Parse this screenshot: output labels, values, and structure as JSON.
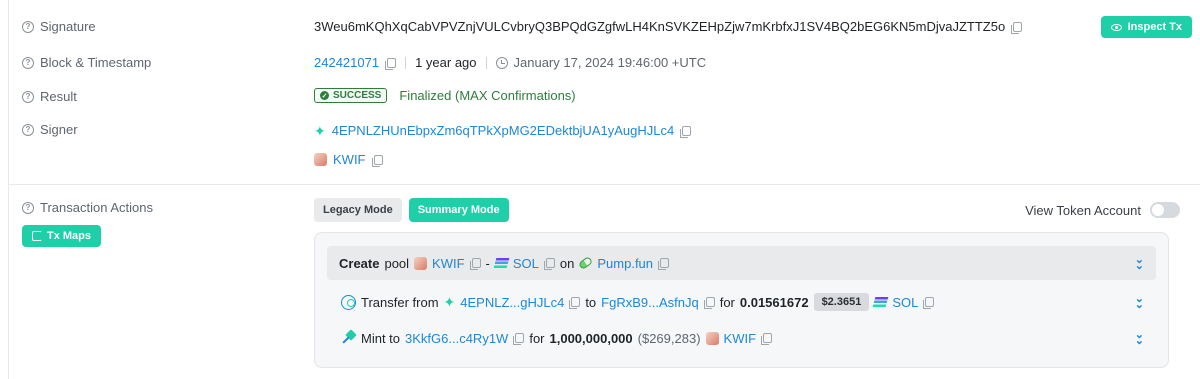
{
  "signature": {
    "label": "Signature",
    "value": "3Weu6mKQhXqCabVPVZnjVULCvbryQ3BPQdGZgfwLH4KnSVKZEHpZjw7mKrbfxJ1SV4BQ2bEG6KN5mDjvaJZTTZ5o",
    "inspect_label": "Inspect Tx"
  },
  "block": {
    "label": "Block & Timestamp",
    "number": "242421071",
    "ago": "1 year ago",
    "timestamp": "January 17, 2024 19:46:00 +UTC"
  },
  "result": {
    "label": "Result",
    "status": "SUCCESS",
    "finalized": "Finalized (MAX Confirmations)"
  },
  "signer": {
    "label": "Signer",
    "address": "4EPNLZHUnEbpxZm6qTPkXpMG2EDektbjUA1yAugHJLc4",
    "token": "KWIF"
  },
  "actions": {
    "label": "Transaction Actions",
    "tx_maps": "Tx Maps",
    "legacy_mode": "Legacy Mode",
    "summary_mode": "Summary Mode",
    "view_token_account": "View Token Account",
    "create": {
      "verb": "Create",
      "obj": "pool",
      "token_a": "KWIF",
      "dash": "-",
      "token_b": "SOL",
      "on": "on",
      "platform": "Pump.fun"
    },
    "transfer": {
      "verb": "Transfer from",
      "from": "4EPNLZ...gHJLc4",
      "to_word": "to",
      "to": "FgRxB9...AsfnJq",
      "for_word": "for",
      "amount": "0.01561672",
      "price": "$2.3651",
      "token": "SOL"
    },
    "mint": {
      "verb": "Mint to",
      "to": "3KkfG6...c4Ry1W",
      "for_word": "for",
      "amount": "1,000,000,000",
      "usd": "($269,283)",
      "token": "KWIF"
    }
  }
}
